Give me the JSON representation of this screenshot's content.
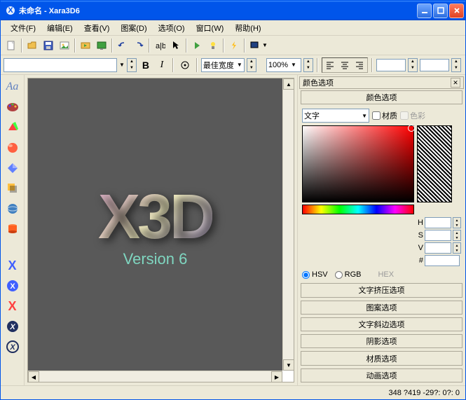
{
  "title": "未命名 - Xara3D6",
  "menu": {
    "file": "文件(F)",
    "edit": "编辑(E)",
    "view": "查看(V)",
    "design": "图案(D)",
    "options": "选项(O)",
    "window": "窗口(W)",
    "help": "帮助(H)"
  },
  "toolbar2": {
    "bold": "B",
    "italic": "I",
    "width_mode": "最佳宽度",
    "zoom": "100%"
  },
  "canvas": {
    "logo": "X3D",
    "version": "Version 6"
  },
  "panel": {
    "header": "颜色选项",
    "section_btn": "颜色选项",
    "target": "文字",
    "material_cb": "材质",
    "color_cb": "色彩",
    "hsv_h": "H",
    "hsv_s": "S",
    "hsv_v": "V",
    "hex": "#",
    "mode_hsv": "HSV",
    "mode_rgb": "RGB",
    "mode_hex": "HEX",
    "opts": {
      "extrude": "文字挤压选项",
      "design": "图案选项",
      "bevel": "文字斜边选项",
      "shadow": "阴影选项",
      "material": "材质选项",
      "anim": "动画选项"
    }
  },
  "status": "348 ?419 -29?: 0?: 0"
}
